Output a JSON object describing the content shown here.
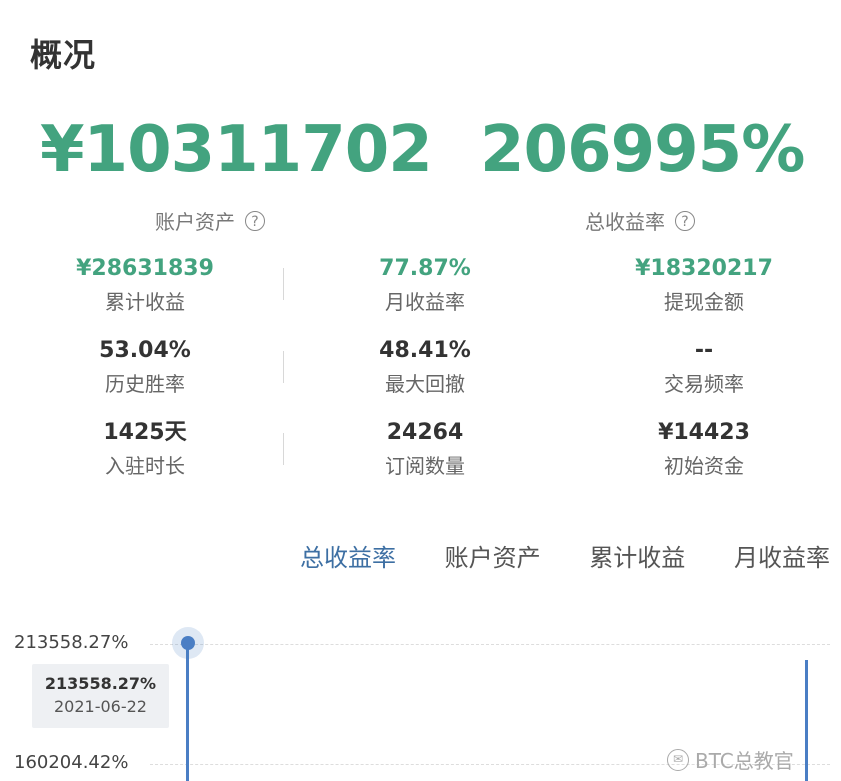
{
  "overview": {
    "title": "概况",
    "account_assets": {
      "value": "¥10311702",
      "label": "账户资产"
    },
    "total_return_rate": {
      "value": "206995%",
      "label": "总收益率"
    },
    "help_icon": "?"
  },
  "stats": [
    {
      "value": "¥28631839",
      "label": "累计收益"
    },
    {
      "value": "77.87%",
      "label": "月收益率"
    },
    {
      "value": "¥18320217",
      "label": "提现金额"
    },
    {
      "value": "53.04%",
      "label": "历史胜率"
    },
    {
      "value": "48.41%",
      "label": "最大回撤"
    },
    {
      "value": "--",
      "label": "交易频率"
    },
    {
      "value": "1425天",
      "label": "入驻时长"
    },
    {
      "value": "24264",
      "label": "订阅数量"
    },
    {
      "value": "¥14423",
      "label": "初始资金"
    }
  ],
  "tabs": [
    {
      "label": "总收益率",
      "active": true
    },
    {
      "label": "账户资产",
      "active": false
    },
    {
      "label": "累计收益",
      "active": false
    },
    {
      "label": "月收益率",
      "active": false
    }
  ],
  "chart": {
    "y_ticks": [
      "213558.27%",
      "160204.42%"
    ],
    "tooltip": {
      "value": "213558.27%",
      "date": "2021-06-22"
    }
  },
  "watermark": "BTC总教官",
  "colors": {
    "green": "#43a37f",
    "accent_blue": "#4a7ec4",
    "active_tab": "#3d6fa3"
  }
}
